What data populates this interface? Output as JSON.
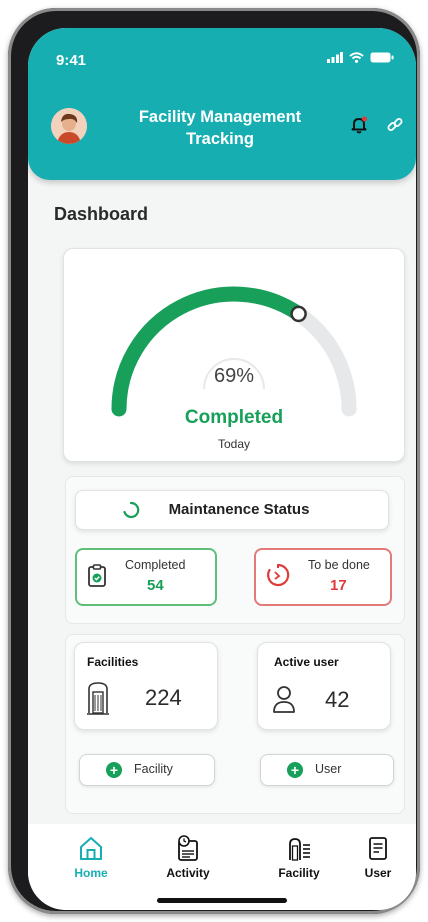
{
  "status_bar": {
    "time": "9:41"
  },
  "header": {
    "title": "Facility Management Tracking"
  },
  "dashboard": {
    "title": "Dashboard"
  },
  "gauge": {
    "percent_label": "69%",
    "value": 0.69,
    "status": "Completed",
    "period": "Today"
  },
  "maintenance": {
    "title": "Maintanence Status",
    "completed_label": "Completed",
    "completed_count": "54",
    "todo_label": "To be done",
    "todo_count": "17"
  },
  "stats": {
    "facilities_label": "Facilities",
    "facilities_count": "224",
    "active_user_label": "Active user",
    "active_user_count": "42"
  },
  "actions": {
    "add_facility": "Facility",
    "add_user": "User"
  },
  "nav": [
    {
      "label": "Home",
      "icon": "home-icon"
    },
    {
      "label": "Activity",
      "icon": "activity-icon"
    },
    {
      "label": "Facility",
      "icon": "facility-icon"
    },
    {
      "label": "User",
      "icon": "user-icon"
    }
  ],
  "colors": {
    "header": "#17aeb2",
    "accent_green": "#18a05a",
    "alert_red": "#e03a3a",
    "track": "#e6e8ea"
  }
}
